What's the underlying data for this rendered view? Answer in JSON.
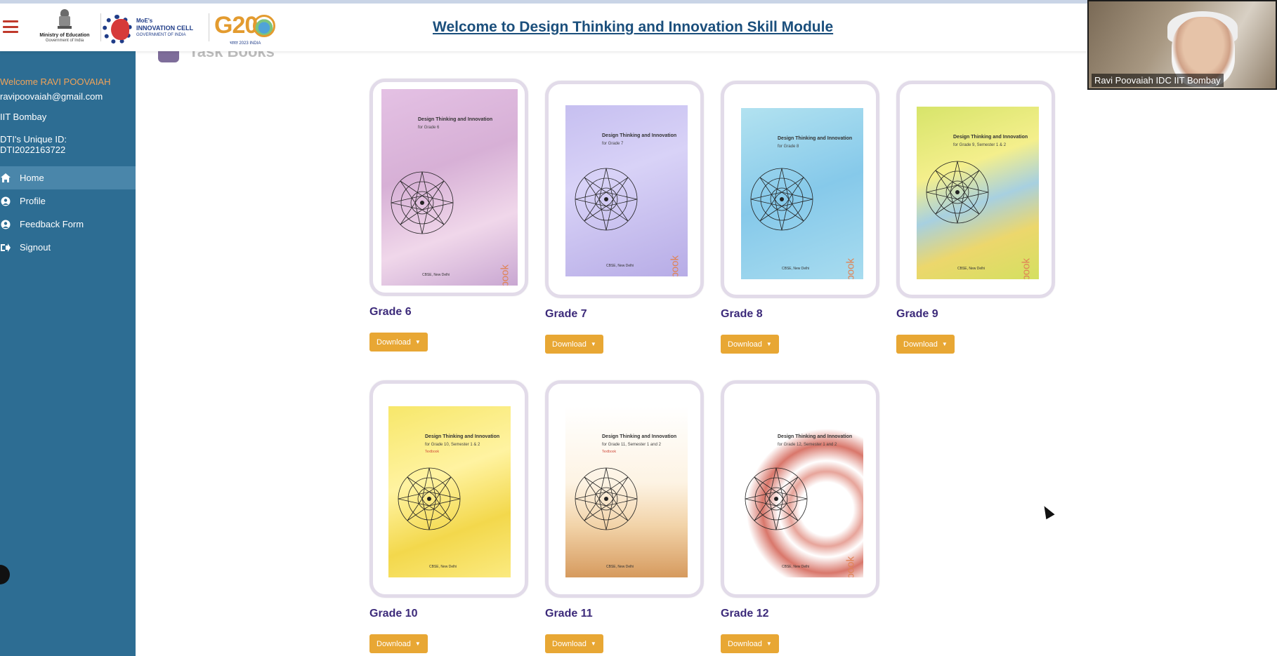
{
  "header": {
    "title": "Welcome to Design Thinking and Innovation Skill Module",
    "moe_line1": "Ministry of Education",
    "moe_line2": "Government of India",
    "mic_line1": "MoE's",
    "mic_line2": "INNOVATION CELL",
    "mic_line3": "GOVERNMENT OF INDIA",
    "g20_text": "G20",
    "g20_sub": "भारत 2023 INDIA"
  },
  "sidebar": {
    "welcome": "Welcome RAVI POOVAIAH",
    "email": "ravipoovaiah@gmail.com",
    "institution": "IIT Bombay",
    "uid_label": "DTI's Unique ID:",
    "uid_value": "DTI2022163722",
    "nav": [
      {
        "label": "Home",
        "icon": "home-icon",
        "active": true
      },
      {
        "label": "Profile",
        "icon": "user-icon",
        "active": false
      },
      {
        "label": "Feedback Form",
        "icon": "user-icon",
        "active": false
      },
      {
        "label": "Signout",
        "icon": "signout-icon",
        "active": false
      }
    ]
  },
  "main": {
    "section_title": "Task Books",
    "books": [
      {
        "grade": "Grade 6",
        "cover_title": "Design Thinking and Innovation",
        "cover_sub": "for Grade 6",
        "cover_type": "Task-book",
        "publisher": "CBSE, New Delhi",
        "download": "Download"
      },
      {
        "grade": "Grade 7",
        "cover_title": "Design Thinking and Innovation",
        "cover_sub": "for Grade 7",
        "cover_type": "Task-book",
        "publisher": "CBSE, New Delhi",
        "download": "Download"
      },
      {
        "grade": "Grade 8",
        "cover_title": "Design Thinking and Innovation",
        "cover_sub": "for Grade 8",
        "cover_type": "Task-book",
        "publisher": "CBSE, New Delhi",
        "download": "Download"
      },
      {
        "grade": "Grade 9",
        "cover_title": "Design Thinking and Innovation",
        "cover_sub": "for Grade 9, Semester 1 & 2",
        "cover_type": "Task-book",
        "publisher": "CBSE, New Delhi",
        "download": "Download"
      },
      {
        "grade": "Grade 10",
        "cover_title": "Design Thinking and Innovation",
        "cover_sub": "for Grade 10, Semester 1 & 2",
        "cover_type": "Textbook",
        "publisher": "CBSE, New Delhi",
        "download": "Download"
      },
      {
        "grade": "Grade 11",
        "cover_title": "Design Thinking and Innovation",
        "cover_sub": "for Grade 11, Semester 1 and 2",
        "cover_type": "Textbook",
        "publisher": "CBSE, New Delhi",
        "download": "Download"
      },
      {
        "grade": "Grade 12",
        "cover_title": "Design Thinking and Innovation",
        "cover_sub": "for Grade 12, Semester 1 and 2",
        "cover_type": "Task-book",
        "publisher": "CBSE, New Delhi",
        "download": "Download"
      }
    ]
  },
  "video": {
    "participant_name": "Ravi Poovaiah IDC IIT Bombay"
  },
  "colors": {
    "sidebar": "#2d6d93",
    "accent_orange": "#e8a734",
    "grade_text": "#3c2a7a",
    "title_blue": "#1b4f7c"
  }
}
